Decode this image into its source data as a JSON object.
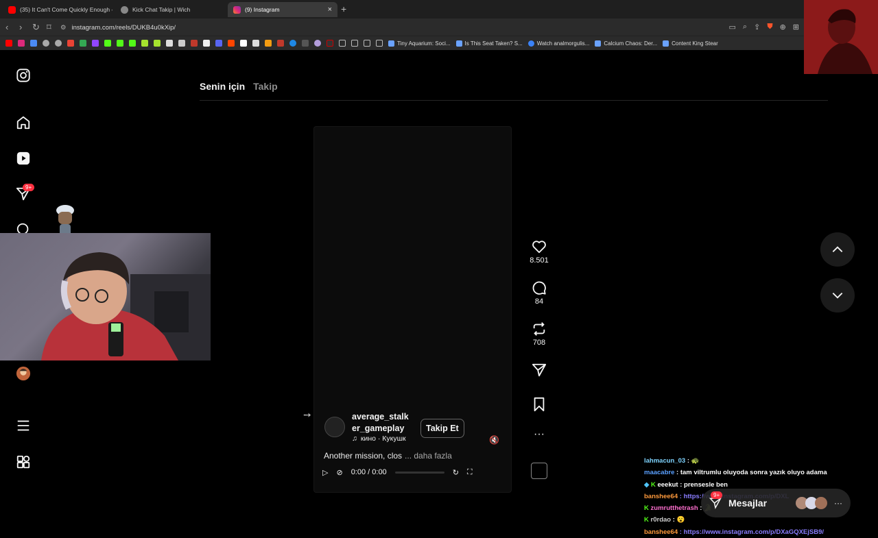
{
  "browser": {
    "tabs": [
      {
        "title": "(35) It Can't Come Quickly Enough - ",
        "color": "#ff0000"
      },
      {
        "title": "Kick Chat Takip | Wich",
        "color": "#888888"
      },
      {
        "title": "(9) Instagram",
        "color": "#e1306c"
      }
    ],
    "new_tab": "+",
    "close": "×",
    "url": "instagram.com/reels/DUKB4u0kXip/",
    "bookmarks": [
      "Tiny Aquarium: Soci...",
      "Is This Seat Taken? S...",
      "Watch analmorgulis...",
      "Calcium Chaos: Der...",
      "Content King Stear"
    ]
  },
  "sidebar": {
    "notification_badge": "9+"
  },
  "feed_tabs": {
    "for_you": "Senin için",
    "following": "Takip"
  },
  "reel": {
    "username": "average_stalker_gameplay",
    "username_line1": "average_stalk",
    "username_line2": "er_gameplay",
    "follow_label": "Takip Et",
    "music": "кино · Кукушк",
    "caption": "Another mission, clos",
    "more": "... daha fazla",
    "time": "0:00 / 0:00"
  },
  "actions": {
    "likes": "8.501",
    "comments": "84",
    "reposts": "708"
  },
  "chat": [
    {
      "user": "lahmacun_03",
      "color": "#7fd4ff",
      "text": " :",
      "emote": "🐢"
    },
    {
      "user": "maacabre",
      "color": "#5aa0ff",
      "text": " : tam viltrumlu oluyoda sonra yazık oluyo adama",
      "emote": ""
    },
    {
      "user": "eeekut",
      "color": "#8fe35a",
      "text": " : prensesle ben",
      "emote": ""
    },
    {
      "user": "banshee64",
      "color": "#ff9a3c",
      "text": " : https://www.instagram.com/p/DXL",
      "emote": ""
    },
    {
      "user": "zumrutthetrash",
      "color": "#ff6fcf",
      "text": " :",
      "emote": ""
    },
    {
      "user": "r0rdao",
      "color": "#cfcfcf",
      "text": " :",
      "emote": "😮"
    },
    {
      "user": "banshee64",
      "color": "#ff9a3c",
      "text": " : https://www.instagram.com/p/DXaGQXEjSB9/",
      "emote": ""
    }
  ],
  "messages": {
    "label": "Mesajlar",
    "badge": "9+"
  },
  "colors": {
    "link": "#8a7dff",
    "badge_red": "#ff3040"
  }
}
